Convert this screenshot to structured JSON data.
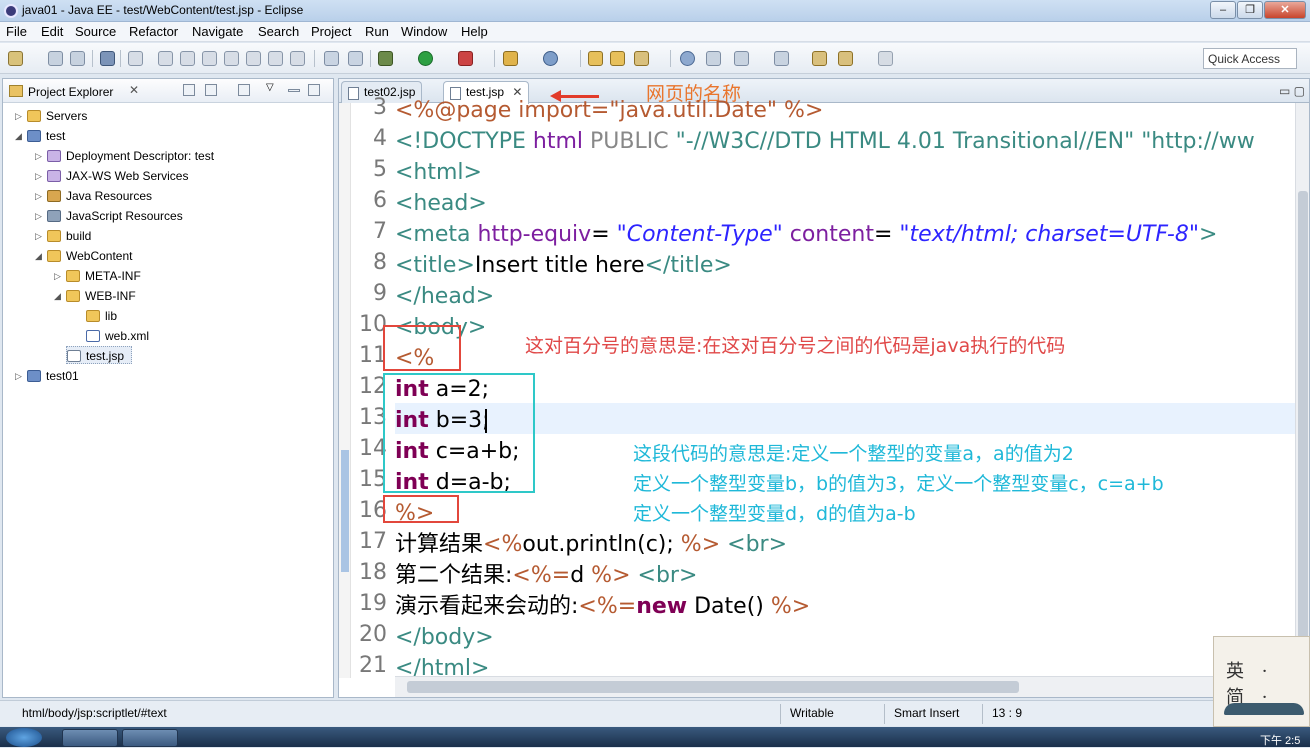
{
  "window": {
    "title": "java01 - Java EE - test/WebContent/test.jsp - Eclipse"
  },
  "menu": [
    "File",
    "Edit",
    "Source",
    "Refactor",
    "Navigate",
    "Search",
    "Project",
    "Run",
    "Window",
    "Help"
  ],
  "toolbar": {
    "quick_access": "Quick Access"
  },
  "project_explorer": {
    "title": "Project Explorer",
    "tree": [
      {
        "label": "Servers"
      },
      {
        "label": "test"
      },
      {
        "label": "Deployment Descriptor: test"
      },
      {
        "label": "JAX-WS Web Services"
      },
      {
        "label": "Java Resources"
      },
      {
        "label": "JavaScript Resources"
      },
      {
        "label": "build"
      },
      {
        "label": "WebContent"
      },
      {
        "label": "META-INF"
      },
      {
        "label": "WEB-INF"
      },
      {
        "label": "lib"
      },
      {
        "label": "web.xml"
      },
      {
        "label": "test.jsp"
      },
      {
        "label": "test01"
      }
    ]
  },
  "editor": {
    "tabs": [
      {
        "label": "test02.jsp"
      },
      {
        "label": "test.jsp"
      }
    ],
    "tab_annotation": "网页的名称",
    "line_numbers": [
      "3",
      "4",
      "5",
      "6",
      "7",
      "8",
      "9",
      "10",
      "11",
      "12",
      "13",
      "14",
      "15",
      "16",
      "17",
      "18",
      "19",
      "20",
      "21"
    ],
    "lines": {
      "l3": "<%@page import=\"java.util.Date\" %>",
      "l4a": "<!DOCTYPE",
      "l4b": " html ",
      "l4c": "PUBLIC ",
      "l4d": "\"-//W3C//DTD HTML 4.01 Transitional//EN\" \"http://ww",
      "l5": "<html>",
      "l6": "<head>",
      "l7a": "<meta ",
      "l7b": "http-equiv",
      "l7c": "=",
      "l7d": " \"Content-Type\"",
      "l7e": " content",
      "l7f": "=",
      "l7g": " \"text/html; charset=UTF-8\"",
      "l7h": ">",
      "l8a": "<title>",
      "l8b": "Insert title here",
      "l8c": "</title>",
      "l9": "</head>",
      "l10": "<body>",
      "l11": "<%",
      "kw_int": "int",
      "l12": " a=2;",
      "l13": " b=3;",
      "l14": " c=a+b;",
      "l15": " d=a-b;",
      "l16": "%>",
      "l17a": "计算结果",
      "l17b": "<%",
      "l17c": "out.println(c); ",
      "l17d": "%>",
      "l17e": " <br>",
      "l18a": "第二个结果:",
      "l18b": "<%=",
      "l18c": "d ",
      "l18d": "%>",
      "l18e": " <br>",
      "l19a": "演示看起来会动的:",
      "l19b": "<%=",
      "kw_new": "new",
      "l19c": " Date() ",
      "l19d": "%>",
      "l20": "</body>",
      "l21": "</html>"
    },
    "annotation_red": "这对百分号的意思是:在这对百分号之间的代码是java执行的代码",
    "annotation_cyan": [
      "这段代码的意思是:定义一个整型的变量a，a的值为2",
      "定义一个整型变量b，b的值为3，定义一个整型变量c，c=a+b",
      "定义一个整型变量d，d的值为a-b"
    ]
  },
  "statusbar": {
    "path": "html/body/jsp:scriptlet/#text",
    "mode": "Writable",
    "insert": "Smart Insert",
    "position": "13 : 9"
  },
  "ime": {
    "label": "英 · 简 ·"
  },
  "tray": {
    "time": "下午 2:5"
  }
}
